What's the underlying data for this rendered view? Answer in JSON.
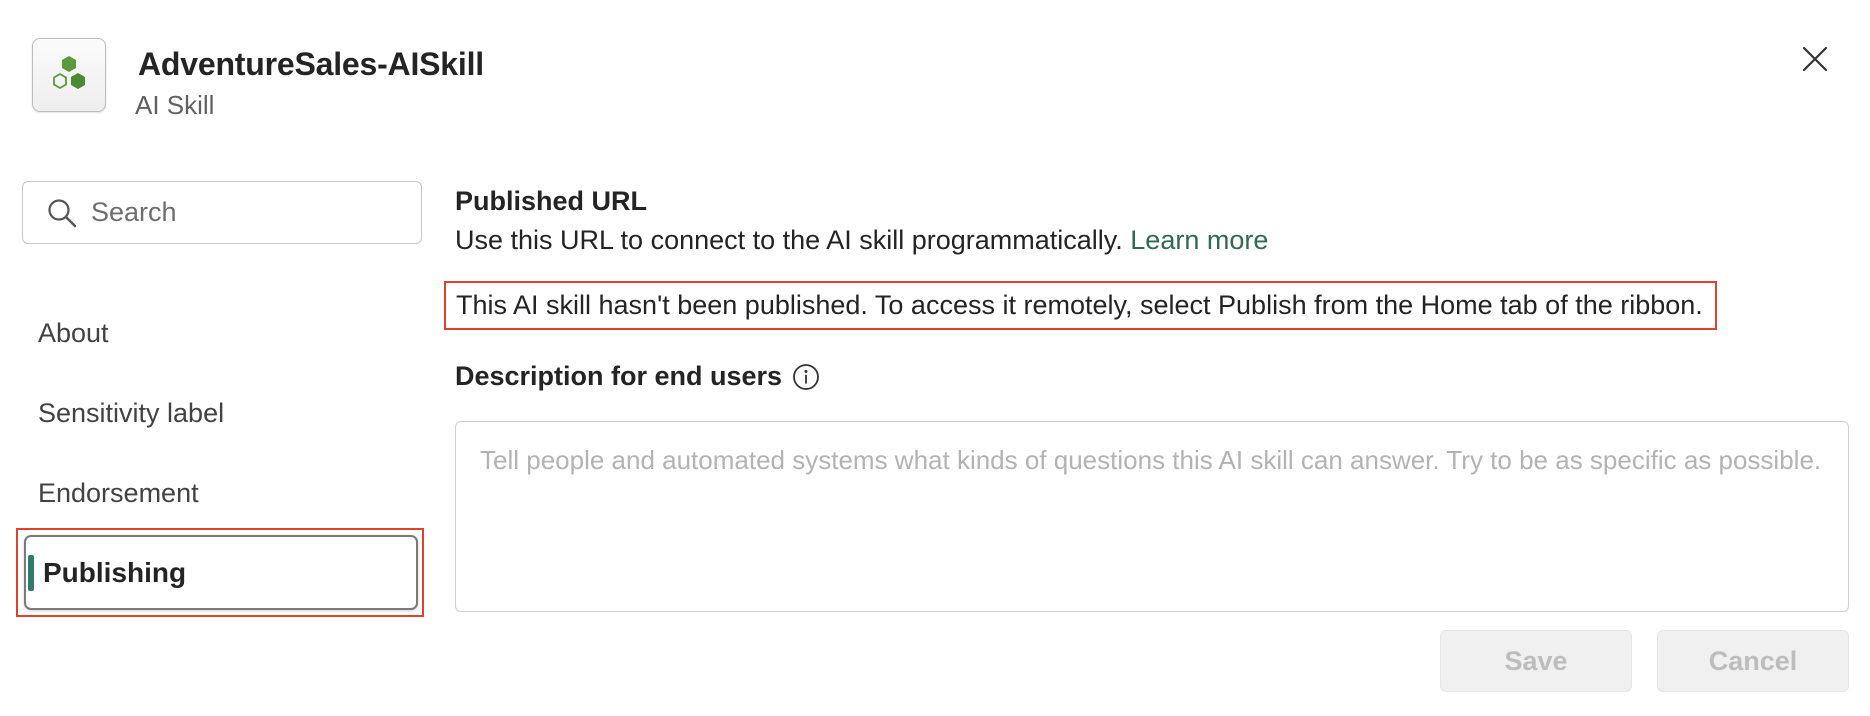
{
  "header": {
    "title": "AdventureSales-AISkill",
    "subtitle": "AI Skill",
    "app_icon": "hexagon-cluster-icon",
    "close_icon": "close-icon"
  },
  "sidebar": {
    "search_placeholder": "Search",
    "items": [
      {
        "label": "About",
        "selected": false
      },
      {
        "label": "Sensitivity label",
        "selected": false
      },
      {
        "label": "Endorsement",
        "selected": false
      },
      {
        "label": "Publishing",
        "selected": true
      }
    ]
  },
  "main": {
    "section_title": "Published URL",
    "url_description": "Use this URL to connect to the AI skill programmatically.",
    "learn_more": "Learn more",
    "warning": "This AI skill hasn't been published. To access it remotely, select Publish from the Home tab of the ribbon.",
    "description_label": "Description for end users",
    "description_value": "",
    "description_placeholder": "Tell people and automated systems what kinds of questions this AI skill can answer. Try to be as specific as possible."
  },
  "buttons": {
    "save": "Save",
    "cancel": "Cancel",
    "disabled": true
  },
  "colors": {
    "accent": "#2e6b4f",
    "selected_indicator": "#2e7d6b",
    "highlight_border": "#e0412c",
    "icon_green": "#5b9a3c"
  }
}
